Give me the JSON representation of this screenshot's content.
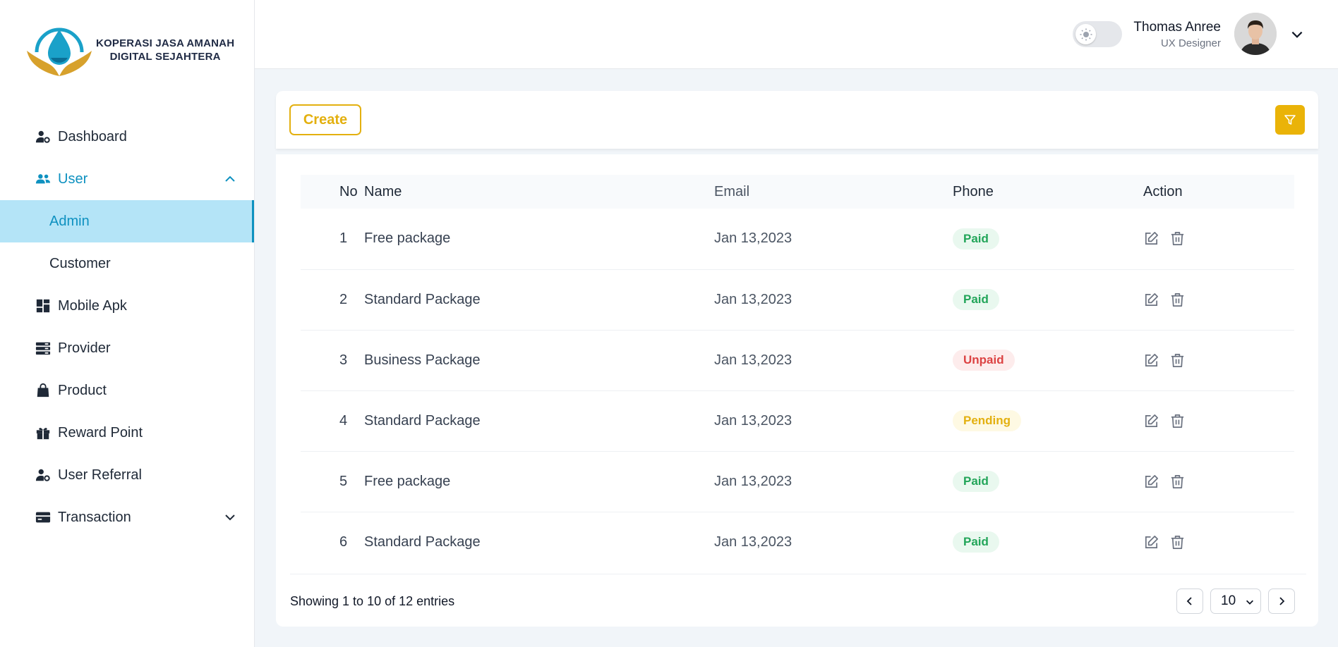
{
  "brand": {
    "line1": "KOPERASI JASA AMANAH",
    "line2": "DIGITAL SEJAHTERA"
  },
  "sidebar": {
    "items": [
      {
        "label": "Dashboard",
        "icon": "user-gear-icon"
      },
      {
        "label": "User",
        "icon": "users-icon",
        "active": true,
        "expanded": true,
        "children": [
          {
            "label": "Admin",
            "selected": true
          },
          {
            "label": "Customer"
          }
        ]
      },
      {
        "label": "Mobile Apk",
        "icon": "dashboard-grid-icon"
      },
      {
        "label": "Provider",
        "icon": "server-icon"
      },
      {
        "label": "Product",
        "icon": "shopping-bag-icon"
      },
      {
        "label": "Reward Point",
        "icon": "gift-icon"
      },
      {
        "label": "User Referral",
        "icon": "user-gear-icon"
      },
      {
        "label": "Transaction",
        "icon": "credit-card-icon",
        "collapsible": true
      }
    ]
  },
  "header": {
    "user_name": "Thomas Anree",
    "user_role": "UX Designer"
  },
  "toolbar": {
    "create_label": "Create"
  },
  "table": {
    "columns": [
      "No",
      "Name",
      "Email",
      "Phone",
      "Action"
    ],
    "rows": [
      {
        "no": "1",
        "name": "Free package",
        "email": "Jan 13,2023",
        "status": "Paid",
        "status_type": "paid"
      },
      {
        "no": "2",
        "name": "Standard Package",
        "email": "Jan 13,2023",
        "status": "Paid",
        "status_type": "paid"
      },
      {
        "no": "3",
        "name": "Business Package",
        "email": "Jan 13,2023",
        "status": "Unpaid",
        "status_type": "unpaid"
      },
      {
        "no": "4",
        "name": "Standard Package",
        "email": "Jan 13,2023",
        "status": "Pending",
        "status_type": "pending"
      },
      {
        "no": "5",
        "name": "Free package",
        "email": "Jan 13,2023",
        "status": "Paid",
        "status_type": "paid"
      },
      {
        "no": "6",
        "name": "Standard Package",
        "email": "Jan 13,2023",
        "status": "Paid",
        "status_type": "paid"
      }
    ]
  },
  "pagination": {
    "summary": "Showing 1 to 10 of 12 entries",
    "page_size": "10"
  },
  "colors": {
    "accent": "#0e91c0",
    "create": "#e3b00f",
    "filter": "#eab308"
  }
}
